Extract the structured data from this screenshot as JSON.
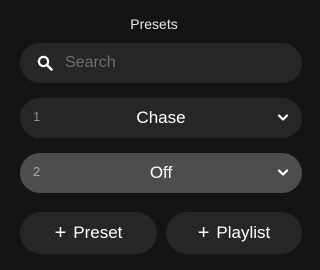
{
  "panel": {
    "title": "Presets"
  },
  "search": {
    "placeholder": "Search",
    "value": "",
    "icon": "search-icon"
  },
  "presets": [
    {
      "number": "1",
      "name": "Chase",
      "icon": "chevron-down-icon"
    },
    {
      "number": "2",
      "name": "Off",
      "icon": "chevron-down-icon"
    }
  ],
  "actions": {
    "plus_symbol": "+",
    "add_preset_label": "Preset",
    "add_playlist_label": "Playlist"
  },
  "colors": {
    "background": "#141414",
    "row_default": "#262626",
    "row_selected": "#4d4d4d",
    "placeholder": "#6d6d6d"
  }
}
